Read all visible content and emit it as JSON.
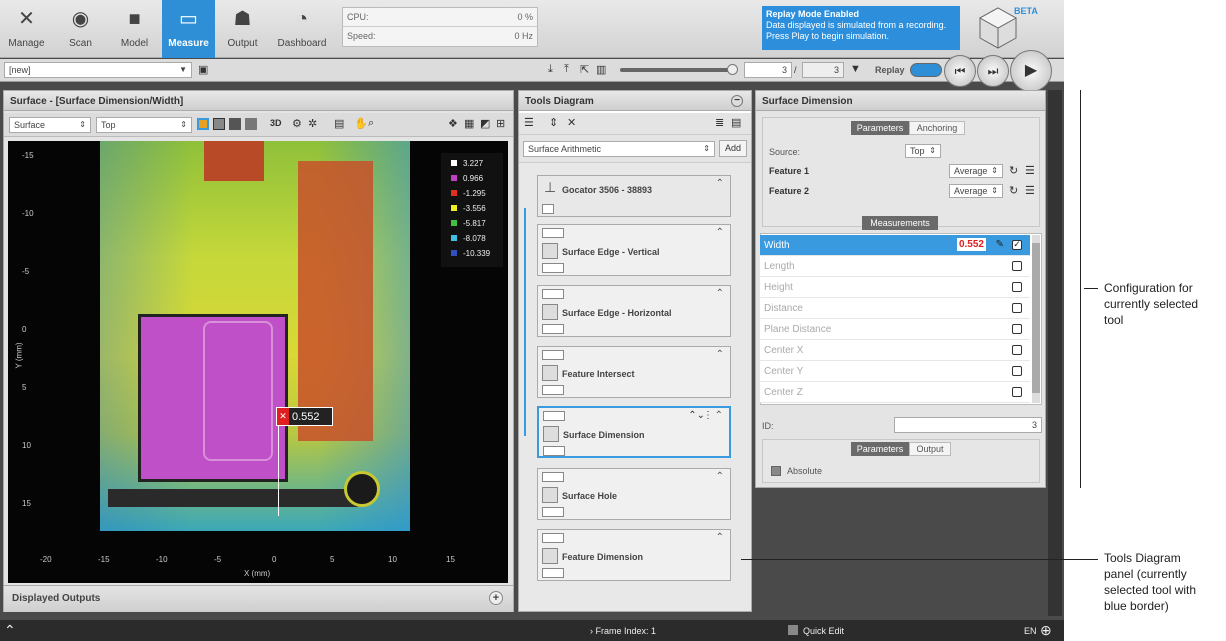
{
  "nav": [
    {
      "label": "Manage",
      "icon": "manage-icon"
    },
    {
      "label": "Scan",
      "icon": "scan-icon"
    },
    {
      "label": "Model",
      "icon": "model-icon"
    },
    {
      "label": "Measure",
      "icon": "measure-icon"
    },
    {
      "label": "Output",
      "icon": "output-icon"
    },
    {
      "label": "Dashboard",
      "icon": "dashboard-icon"
    }
  ],
  "stats": {
    "cpu_label": "CPU:",
    "cpu_value": "0 %",
    "speed_label": "Speed:",
    "speed_value": "0 Hz"
  },
  "replay_banner": {
    "title": "Replay Mode Enabled",
    "line1": "Data displayed is simulated from a recording.",
    "line2": "Press Play to begin simulation."
  },
  "logo": {
    "badge": "BETA"
  },
  "toolbar": {
    "job": "[new]",
    "frame_current": "3",
    "frame_sep": "/",
    "frame_total": "3",
    "replay_label": "Replay"
  },
  "surface_panel": {
    "title": "Surface - [Surface Dimension/Width]",
    "view_select": "Surface",
    "side_select": "Top",
    "btn_3d": "3D",
    "legend": [
      {
        "value": "3.227",
        "color": "#ffffff"
      },
      {
        "value": "0.966",
        "color": "#c040c0"
      },
      {
        "value": "-1.295",
        "color": "#e03020"
      },
      {
        "value": "-3.556",
        "color": "#f0f020"
      },
      {
        "value": "-5.817",
        "color": "#40c040"
      },
      {
        "value": "-8.078",
        "color": "#40c0e0"
      },
      {
        "value": "-10.339",
        "color": "#3050c0"
      }
    ],
    "y_ticks": [
      "-15",
      "-10",
      "-5",
      "0",
      "5",
      "10",
      "15"
    ],
    "x_ticks": [
      "-20",
      "-15",
      "-10",
      "-5",
      "0",
      "5",
      "10",
      "15"
    ],
    "x_label": "X (mm)",
    "y_label": "Y (mm)",
    "measure_value": "0.552",
    "displayed_outputs": "Displayed Outputs"
  },
  "tools_panel": {
    "title": "Tools Diagram",
    "add_select": "Surface Arithmetic",
    "add_button": "Add",
    "root": "Gocator 3506 - 38893",
    "tools": [
      "Surface Edge - Vertical",
      "Surface Edge - Horizontal",
      "Feature Intersect",
      "Surface Dimension",
      "Surface Hole",
      "Feature Dimension"
    ]
  },
  "config_panel": {
    "title": "Surface Dimension",
    "tab_parameters": "Parameters",
    "tab_anchoring": "Anchoring",
    "source_label": "Source:",
    "source_value": "Top",
    "feature1_label": "Feature 1",
    "feature1_value": "Average",
    "feature2_label": "Feature 2",
    "feature2_value": "Average",
    "measurements_label": "Measurements",
    "measurements": [
      {
        "name": "Width",
        "value": "0.552"
      },
      {
        "name": "Length"
      },
      {
        "name": "Height"
      },
      {
        "name": "Distance"
      },
      {
        "name": "Plane Distance"
      },
      {
        "name": "Center X"
      },
      {
        "name": "Center Y"
      },
      {
        "name": "Center Z"
      }
    ],
    "id_label": "ID:",
    "id_value": "3",
    "subtab_parameters": "Parameters",
    "subtab_output": "Output",
    "absolute_label": "Absolute"
  },
  "status": {
    "frame_index": "Frame Index: 1",
    "quick_edit": "Quick Edit",
    "lang": "EN"
  },
  "annotations": {
    "config": [
      "Configuration for",
      "currently selected",
      "tool"
    ],
    "tools": [
      "Tools Diagram",
      "panel (currently",
      "selected tool with",
      "blue border)"
    ]
  },
  "colors": {
    "accent": "#2f8fd6",
    "selected": "#3a9ae0",
    "value_red": "#e02020"
  }
}
